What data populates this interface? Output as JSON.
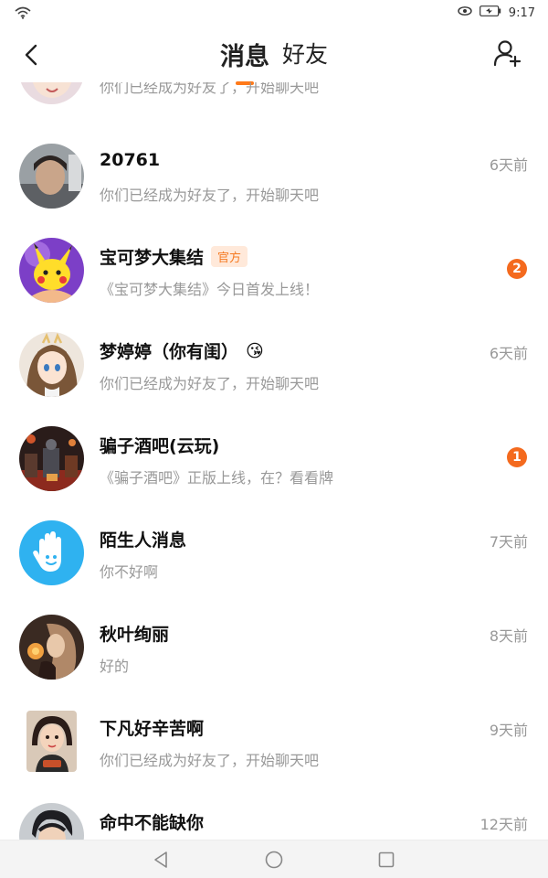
{
  "status_bar": {
    "time": "9:17"
  },
  "header": {
    "tabs": [
      {
        "label": "消息",
        "active": true
      },
      {
        "label": "好友",
        "active": false
      }
    ]
  },
  "conversations": [
    {
      "name": "",
      "preview": "你们已经成为好友了，开始聊天吧",
      "time": "",
      "badge": ""
    },
    {
      "name": "20761",
      "preview": "你们已经成为好友了，开始聊天吧",
      "time": "6天前",
      "badge": ""
    },
    {
      "name": "宝可梦大集结",
      "tag": "官方",
      "preview": "《宝可梦大集结》今日首发上线！",
      "time": "",
      "badge": "2"
    },
    {
      "name": "梦婷婷（你有闺）",
      "emoji": "😘",
      "preview": "你们已经成为好友了，开始聊天吧",
      "time": "6天前",
      "badge": ""
    },
    {
      "name": "骗子酒吧(云玩)",
      "preview": "《骗子酒吧》正版上线，在？看看牌",
      "time": "",
      "badge": "1"
    },
    {
      "name": "陌生人消息",
      "preview": "你不好啊",
      "time": "7天前",
      "badge": ""
    },
    {
      "name": "秋叶绚丽",
      "preview": "好的",
      "time": "8天前",
      "badge": ""
    },
    {
      "name": "下凡好辛苦啊",
      "preview": "你们已经成为好友了，开始聊天吧",
      "time": "9天前",
      "badge": ""
    },
    {
      "name": "命中不能缺你",
      "preview": "",
      "time": "12天前",
      "badge": ""
    }
  ],
  "colors": {
    "accent": "#ff7a1a",
    "badge": "#f46a1e",
    "stranger_avatar": "#2fb2f0"
  }
}
